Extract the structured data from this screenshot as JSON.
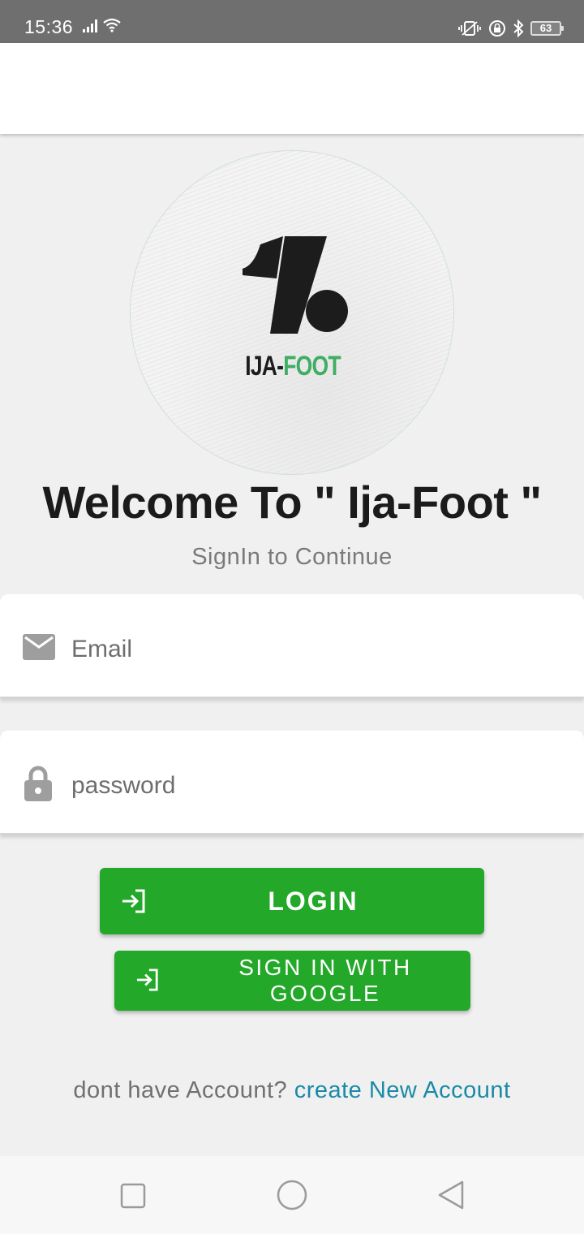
{
  "status_bar": {
    "time": "15:36",
    "battery": "63"
  },
  "brand": {
    "name_part1": "IJA-",
    "name_part2": "FOOT",
    "accent_color": "#3fae63"
  },
  "welcome": {
    "title": "Welcome To \" Ija-Foot \"",
    "subtitle": "SignIn to Continue"
  },
  "form": {
    "email_placeholder": "Email",
    "password_placeholder": "password",
    "email_icon": "mail-icon",
    "password_icon": "lock-icon"
  },
  "buttons": {
    "login_label": "LOGIN",
    "google_label": "SIGN IN WITH GOOGLE",
    "icon": "login-icon",
    "color": "#23a829"
  },
  "footer": {
    "prompt": "dont have Account? ",
    "link": "create New Account",
    "link_color": "#198aa5"
  },
  "nav": {
    "recents_icon": "square-icon",
    "home_icon": "circle-icon",
    "back_icon": "triangle-back-icon"
  }
}
